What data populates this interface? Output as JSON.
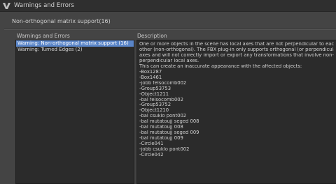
{
  "window": {
    "title": "Warnings and Errors"
  },
  "header": {
    "title": "Non-orthogonal matrix support(16)"
  },
  "warnings_panel": {
    "label": "Warnings and Errors",
    "items": [
      {
        "label": "Warning: Non-orthogonal matrix support (16)",
        "selected": true
      },
      {
        "label": "Warning: Turned Edges (2)",
        "selected": false
      }
    ]
  },
  "description_panel": {
    "label": "Description",
    "lines": [
      "One or more objects in the scene has local axes that are not perpendicular to each",
      "other (non-orthogonal). The FBX plug-in only supports orthogonal (or perpendicular)",
      "axes and will not correctly import or export any transformations that involve non-",
      "perpendicular local axes.",
      "This can create an inaccurate appearance with the affected objects:",
      "-Box1287",
      "-Box1461",
      "-jobb felsocomb002",
      "-Group53753",
      "-Object1211",
      "-bal felsocomb002",
      "-Group53752",
      "-Object1210",
      "-bal csuklo pont002",
      "-bal mutatoujj seged 008",
      "-bal mutatoujj 008",
      "-bal mutatoujj seged 009",
      "-bal mutatoujj 009",
      "-Circle041",
      "-jobb csuklo pont002",
      "-Circle042"
    ]
  },
  "colors": {
    "selection": "#5a85c8",
    "background": "#444444",
    "panel": "#2b2b2b",
    "titlebar": "#2f2f2f"
  },
  "icons": {
    "app": "3ds-max-logo-icon"
  }
}
